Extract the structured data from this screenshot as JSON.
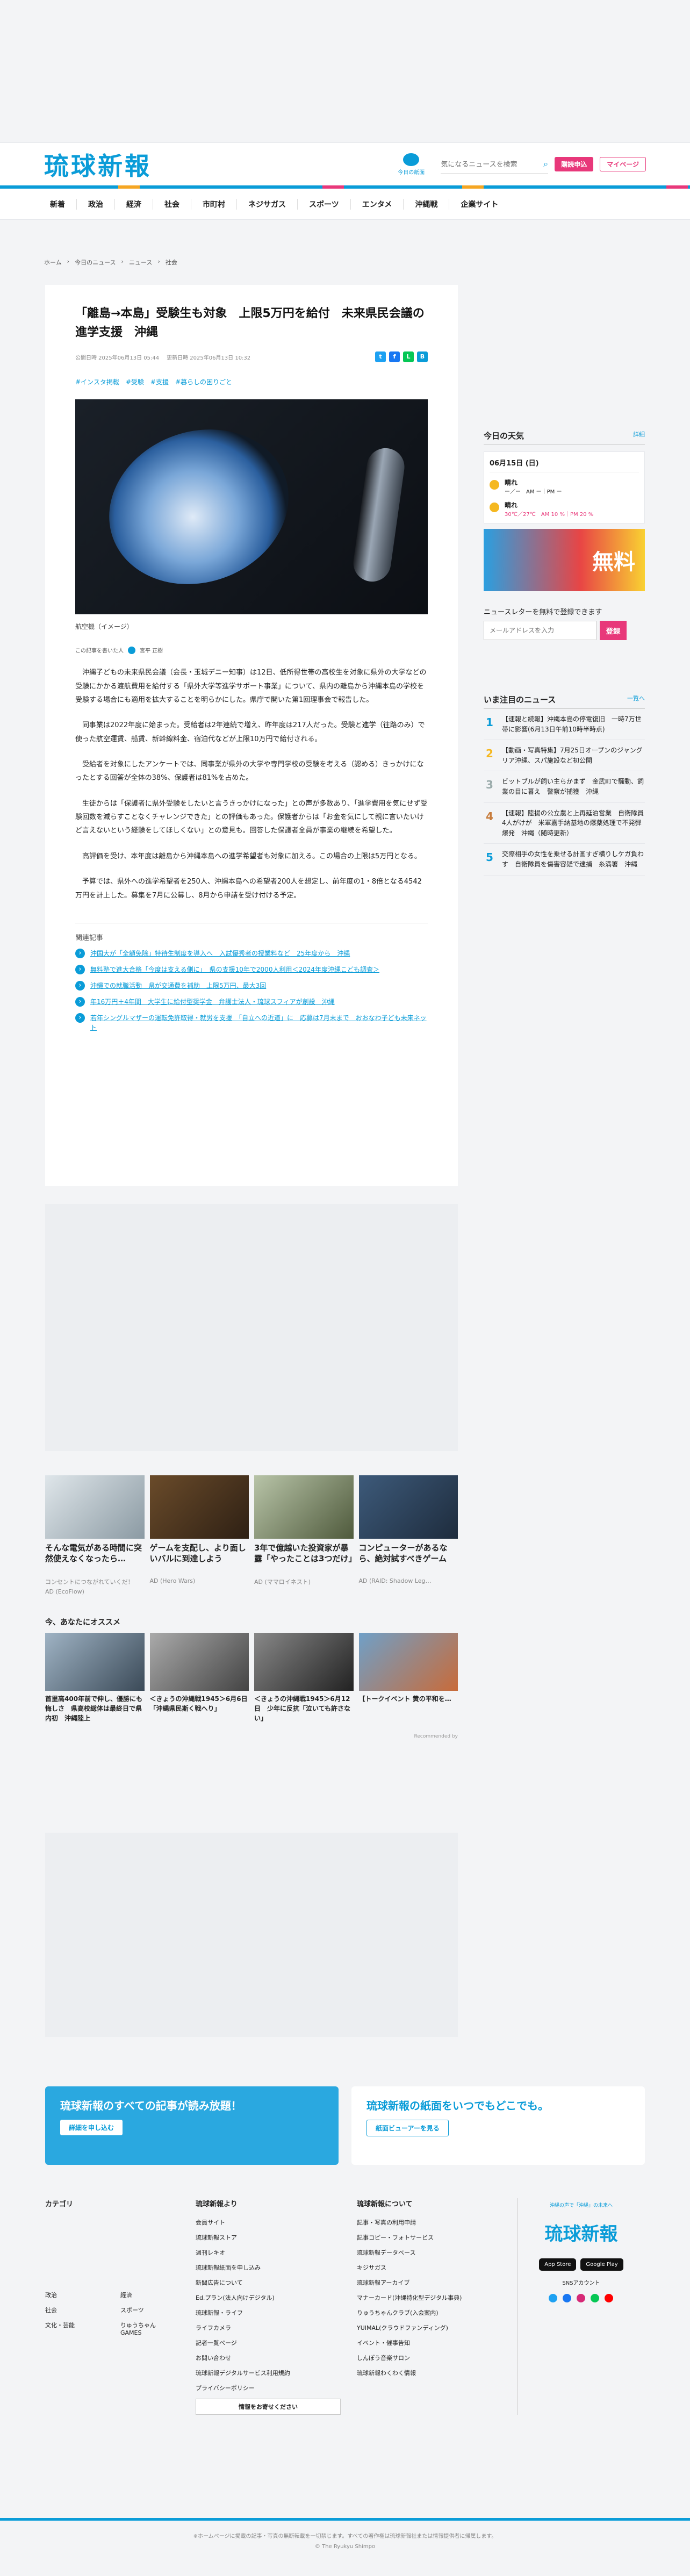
{
  "header": {
    "logo": "琉球新報",
    "logo_sub": "RYUKYU SHIMPO",
    "paper_label": "今日の紙面",
    "search_placeholder": "気になるニュースを検索",
    "subscribe_label": "購読申込",
    "mypage_label": "マイページ"
  },
  "nav": [
    "新着",
    "政治",
    "経済",
    "社会",
    "市町村",
    "ネジサガス",
    "スポーツ",
    "エンタメ",
    "沖縄戦",
    "企業サイト"
  ],
  "breadcrumb": [
    "ホーム",
    "今日のニュース",
    "ニュース",
    "社会"
  ],
  "article": {
    "title": "「離島→本島」受験生も対象　上限5万円を給付　未来県民会議の進学支援　沖縄",
    "published": "公開日時 2025年06月13日 05:44",
    "updated": "更新日時 2025年06月13日 10:32",
    "tags": [
      "#インスタ掲載",
      "#受験",
      "#支援",
      "#暮らしの困りごと"
    ],
    "caption": "航空機（イメージ）",
    "author_label": "この記事を書いた人",
    "author": "宮平 正樹",
    "paragraphs": [
      "沖縄子どもの未来県民会議（会長・玉城デニー知事）は12日、低所得世帯の高校生を対象に県外の大学などの受験にかかる渡航費用を給付する「県外大学等進学サポート事業」について、県内の離島から沖縄本島の学校を受験する場合にも適用を拡大することを明らかにした。県庁で開いた第1回理事会で報告した。",
      "同事業は2022年度に始まった。受給者は2年連続で増え、昨年度は217人だった。受験と進学（往路のみ）で使った航空運賃、船賃、新幹線料金、宿泊代などが上限10万円で給付される。",
      "受給者を対象にしたアンケートでは、同事業が県外の大学や専門学校の受験を考える（認める）きっかけになったとする回答が全体の38%、保護者は81%を占めた。",
      "生徒からは「保護者に県外受験をしたいと言うきっかけになった」との声が多数あり、「進学費用を気にせず受験回数を減らすことなくチャレンジできた」との評価もあった。保護者からは「お金を気にして親に言いたいけど言えないという経験をしてほしくない」との意見も。回答した保護者全員が事業の継続を希望した。",
      "高評価を受け、本年度は離島から沖縄本島への進学希望者も対象に加える。この場合の上限は5万円となる。",
      "予算では、県外への進学希望者を250人、沖縄本島への希望者200人を想定し、前年度の1・8倍となる4542万円を計上した。募集を7月に公募し、8月から申請を受け付ける予定。"
    ],
    "related_title": "関連記事",
    "related": [
      "沖国大が「全額免除」特待生制度を導入へ　入試優秀者の授業料など　25年度から　沖縄",
      "無料塾で進大合格「今度は支える側に」　県の支援10年で2000人利用＜2024年度沖縄こども調査＞",
      "沖縄での就職活動　県が交通費を補助　上限5万円、最大3回",
      "年16万円＋4年間　大学生に給付型奨学金　弁護士法人・琉球スフィアが創設　沖縄",
      "若年シングルマザーの運転免許取得・就労を支援　「自立への近道」に　応募は7月末まで　おおなわ子ども未来ネット"
    ]
  },
  "sidebar": {
    "weather_title": "今日の天気",
    "weather_more": "詳細",
    "weather_date": "06月15日 (日)",
    "weather_rows": [
      {
        "label": "晴れ",
        "detail": "ー／ー　AM ー｜PM ー"
      },
      {
        "label": "晴れ",
        "detail": "30℃／27℃　AM 10 %｜PM 20 %"
      }
    ],
    "banner_text": "無料",
    "newsletter_title": "ニュースレターを無料で登録できます",
    "newsletter_placeholder": "メールアドレスを入力",
    "newsletter_button": "登録",
    "ranking_title": "いま注目のニュース",
    "ranking_more": "一覧へ",
    "ranking": [
      "【速報と続報】沖縄本島の停電復旧　一時7万世帯に影響(6月13日午前10時半時点)",
      "【動画・写真特集】7月25日オープンのジャングリア沖縄、スパ施設など初公開",
      "ビットブルが飼い主らかまず　金武町で騒動、飼業の目に暮え　警察が捕獲　沖縄",
      "【速報】陸揚の公立農と上再延泊営業　自衛隊員4人がけが　米軍嘉手納基地の爆薬処理で不発弾爆発　沖縄（随時更新）",
      "交際相手の女性を乗せる計画すぎ横りしケガ負わす　自衛隊員を傷害容疑で逮捕　糸満署　沖縄"
    ]
  },
  "ads": {
    "cards": [
      {
        "title": "そんな電気がある時間に突然使えなくなったら…",
        "source": "コンセントにつながれていくだ！",
        "sponsor": "AD (EcoFlow)"
      },
      {
        "title": "ゲームを支配し、より面しいバルに到達しよう",
        "source": "AD (Hero Wars)"
      },
      {
        "title": "3年で億越いた投資家が暴露「やったことは3つだけ」",
        "source": "AD (ママロイネスト)"
      },
      {
        "title": "コンピューターがあるなら、絶対試すべきゲーム",
        "source": "AD (RAID: Shadow Leg…"
      }
    ],
    "reco_title": "今、あなたにオススメ",
    "recos": [
      "首里高400年前で伸し、優勝にも悔しさ　県高校総体は最終日で県内初　沖縄陸上",
      "＜きょうの沖縄戦1945＞6月6日「沖縄県民斯く戦へり」",
      "＜きょうの沖縄戦1945＞6月12日　少年に反抗「泣いても許さない」",
      "【トークイベント"
    ],
    "reco_tail": "黄の平和を…",
    "recommended_by": "Recommended by"
  },
  "promos": [
    {
      "title": "琉球新報のすべての記事が読み放題！",
      "button": "詳細を申し込む"
    },
    {
      "title": "琉球新報の紙面をいつでもどこでも。",
      "button": "紙面ビューアーを見る"
    }
  ],
  "footer": {
    "cat_title": "カテゴリ",
    "cats": [
      "政治",
      "経済",
      "社会",
      "スポーツ",
      "文化・芸能",
      "りゅうちゃんGAMES"
    ],
    "from_title": "琉球新報より",
    "from": [
      "会員サイト",
      "琉球新報ストア",
      "週刊レキオ",
      "琉球新報紙面を申し込み",
      "新聞広告について",
      "Ed.プラン(法人向けデジタル)",
      "琉球新報・ライフ",
      "ライフカメラ",
      "記者一覧ページ",
      "お問い合わせ",
      "琉球新報デジタルサービス利用規約",
      "プライバシーポリシー"
    ],
    "about_title": "琉球新報について",
    "about": [
      "記事・写真の利用申請",
      "記事コピー・フォトサービス",
      "琉球新報データベース",
      "キジサガス",
      "琉球新報アーカイブ",
      "マナーカード(沖縄特化型デジタル事典)",
      "りゅうちゃんクラブ(入会案内)",
      "YUIMAL(クラウドファンディング)",
      "イベント・催事告知",
      "しんぽう音楽サロン",
      "琉球新報わくわく情報"
    ],
    "contact_button": "情報をお寄せください",
    "logo": "琉球新報",
    "logo_sub": "沖縄の声で「沖縄」の未来へ",
    "app_store": "App Store",
    "google_play": "Google Play",
    "sns_label": "SNSアカウント",
    "copyright": "© The Ryukyu Shimpo",
    "notice": "※ホームページに掲載の記事・写真の無断転載を一切禁じます。すべての著作権は琉球新報社または情報提供者に帰属します。"
  }
}
